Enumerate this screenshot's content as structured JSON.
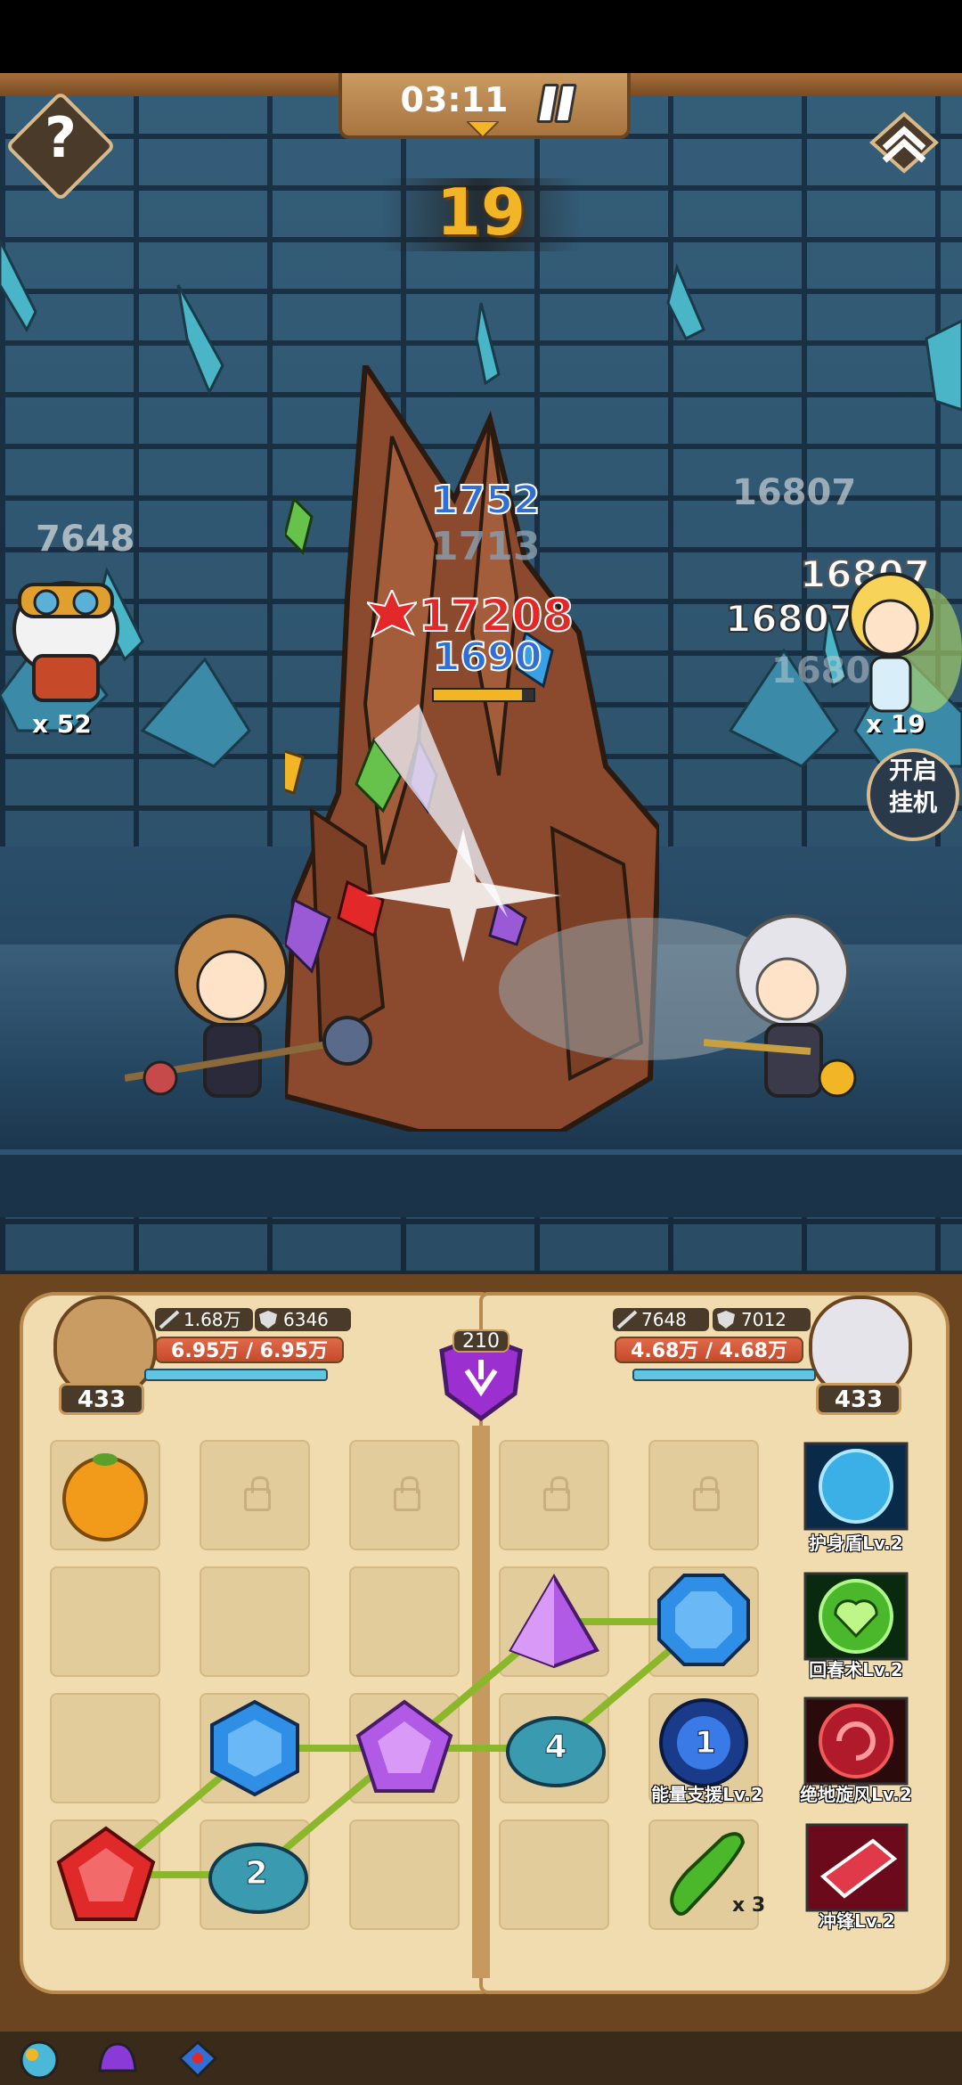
{
  "hud": {
    "timer": "03:11",
    "wave": "19",
    "help_label": "?"
  },
  "combat": {
    "left_ally_count": "x 52",
    "right_ally_count": "x 19",
    "left_ally_damage": "7648",
    "right_ally_damage_1": "16807",
    "right_ally_damage_2": "16807",
    "right_ally_damage_3": "16807",
    "right_ally_damage_4": "1680",
    "enemy_dmg_1": "1752",
    "enemy_dmg_2": "1713",
    "enemy_dmg_crit": "17208",
    "enemy_dmg_3": "1690",
    "enemy_hp_fraction": 0.88,
    "afk_line1": "开启",
    "afk_line2": "挂机"
  },
  "left_hero": {
    "attack": "1.68万",
    "defense": "6346",
    "hp": "6.95万 / 6.95万",
    "level": "433"
  },
  "right_hero": {
    "attack": "7648",
    "defense": "7012",
    "hp": "4.68万 / 4.68万",
    "level": "433"
  },
  "crest": {
    "value": "210"
  },
  "board": {
    "slime_left_number": "2",
    "slime_right_number": "4",
    "skill_1": "护身盾Lv.2",
    "skill_2": "回春术Lv.2",
    "skill_3": "能量支援Lv.2",
    "skill_4": "绝地旋风Lv.2",
    "skill_5": "冲锋Lv.2",
    "skill_3_badge": "1",
    "cucumber_count": "x 3"
  },
  "colors": {
    "wave": "#f2b526",
    "crit": "#e3282a",
    "blue_dmg": "#2f6fd6",
    "page": "#f1dcb0"
  }
}
